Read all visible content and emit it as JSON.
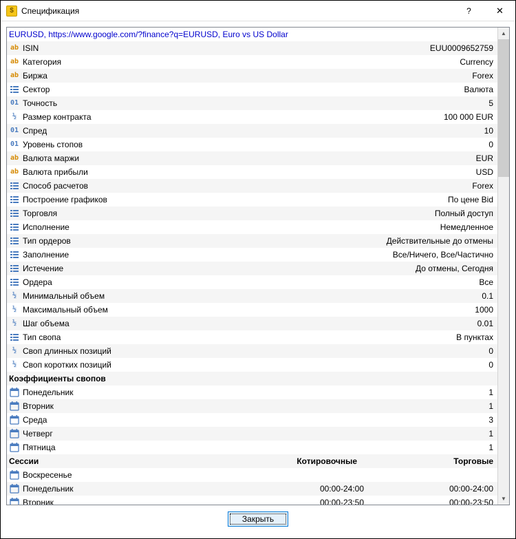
{
  "window": {
    "title": "Спецификация"
  },
  "header_link": "EURUSD, https://www.google.com/?finance?q=EURUSD, Euro vs US Dollar",
  "properties": [
    {
      "icon": "ab",
      "label": "ISIN",
      "value": "EUU0009652759"
    },
    {
      "icon": "ab",
      "label": "Категория",
      "value": "Currency"
    },
    {
      "icon": "ab",
      "label": "Биржа",
      "value": "Forex"
    },
    {
      "icon": "list",
      "label": "Сектор",
      "value": "Валюта"
    },
    {
      "icon": "num",
      "label": "Точность",
      "value": "5"
    },
    {
      "icon": "frac",
      "label": "Размер контракта",
      "value": "100 000 EUR"
    },
    {
      "icon": "num",
      "label": "Спред",
      "value": "10"
    },
    {
      "icon": "num",
      "label": "Уровень стопов",
      "value": "0"
    },
    {
      "icon": "ab",
      "label": "Валюта маржи",
      "value": "EUR"
    },
    {
      "icon": "ab",
      "label": "Валюта прибыли",
      "value": "USD"
    },
    {
      "icon": "list",
      "label": "Способ расчетов",
      "value": "Forex"
    },
    {
      "icon": "list",
      "label": "Построение графиков",
      "value": "По цене Bid"
    },
    {
      "icon": "list",
      "label": "Торговля",
      "value": "Полный доступ"
    },
    {
      "icon": "list",
      "label": "Исполнение",
      "value": "Немедленное"
    },
    {
      "icon": "list",
      "label": "Тип ордеров",
      "value": "Действительные до отмены"
    },
    {
      "icon": "list",
      "label": "Заполнение",
      "value": "Все/Ничего, Все/Частично"
    },
    {
      "icon": "list",
      "label": "Истечение",
      "value": "До отмены, Сегодня"
    },
    {
      "icon": "list",
      "label": "Ордера",
      "value": "Все"
    },
    {
      "icon": "frac",
      "label": "Минимальный объем",
      "value": "0.1"
    },
    {
      "icon": "frac",
      "label": "Максимальный объем",
      "value": "1000"
    },
    {
      "icon": "frac",
      "label": "Шаг объема",
      "value": "0.01"
    },
    {
      "icon": "list",
      "label": "Тип свопа",
      "value": "В пунктах"
    },
    {
      "icon": "frac",
      "label": "Своп длинных позиций",
      "value": "0"
    },
    {
      "icon": "frac",
      "label": "Своп коротких позиций",
      "value": "0"
    }
  ],
  "swap_header": "Коэффициенты свопов",
  "swap_days": [
    {
      "label": "Понедельник",
      "value": "1"
    },
    {
      "label": "Вторник",
      "value": "1"
    },
    {
      "label": "Среда",
      "value": "3"
    },
    {
      "label": "Четверг",
      "value": "1"
    },
    {
      "label": "Пятница",
      "value": "1"
    }
  ],
  "sessions_header": {
    "col1": "Сессии",
    "col2": "Котировочные",
    "col3": "Торговые"
  },
  "sessions": [
    {
      "label": "Воскресенье",
      "quote": "",
      "trade": ""
    },
    {
      "label": "Понедельник",
      "quote": "00:00-24:00",
      "trade": "00:00-24:00"
    },
    {
      "label": "Вторник",
      "quote": "00:00-23:50",
      "trade": "00:00-23:50"
    }
  ],
  "footer": {
    "close_label": "Закрыть"
  }
}
